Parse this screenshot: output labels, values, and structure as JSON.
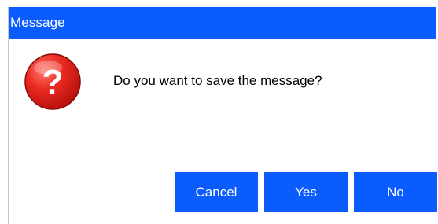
{
  "window": {
    "title": "Message"
  },
  "dialog": {
    "icon": "question-mark-icon",
    "message": "Do you want to save the message?"
  },
  "buttons": {
    "cancel_label": "Cancel",
    "yes_label": "Yes",
    "no_label": "No"
  },
  "colors": {
    "titlebar": "#0a5cff",
    "button": "#0a5cff",
    "icon_red": "#e0211d"
  }
}
